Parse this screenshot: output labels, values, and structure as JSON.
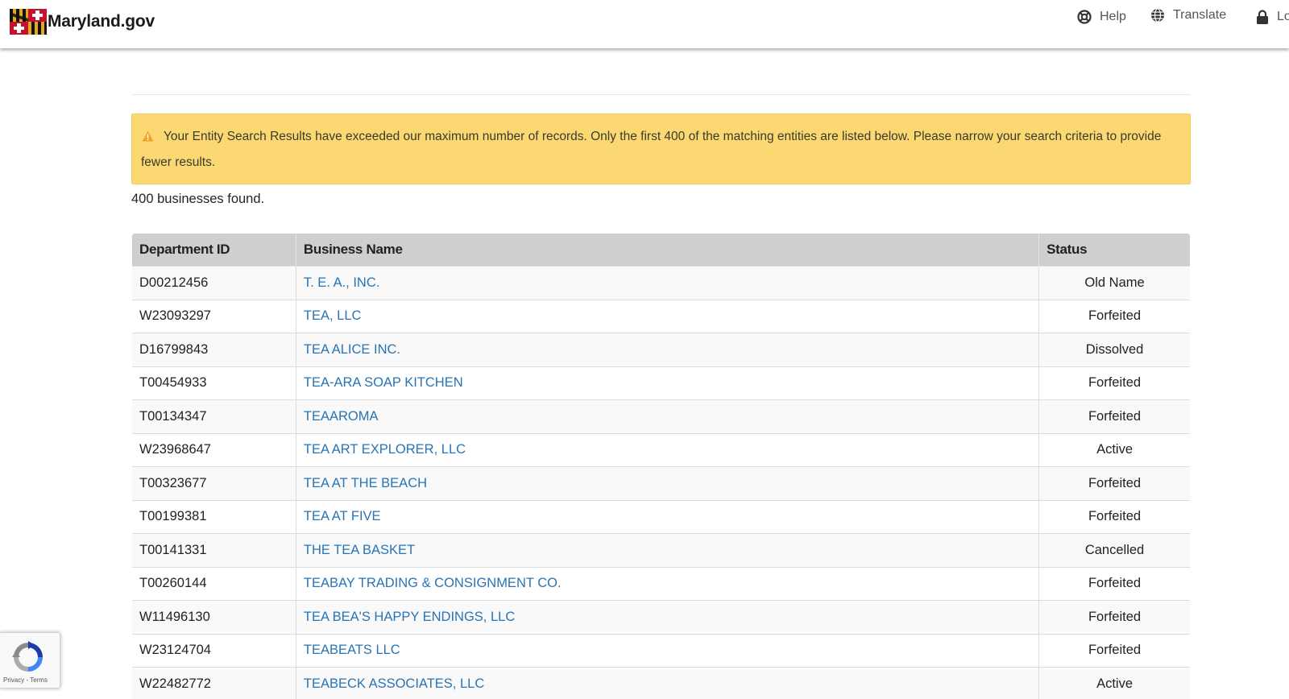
{
  "header": {
    "site_name": "Maryland.gov",
    "nav": {
      "help": "Help",
      "translate": "Translate",
      "login": "Lo"
    }
  },
  "alert": {
    "message": "Your Entity Search Results have exceeded our maximum number of records. Only the first 400 of the matching entities are listed below. Please narrow your search criteria to provide fewer results."
  },
  "results_count": "400 businesses found.",
  "table": {
    "headers": {
      "id": "Department ID",
      "name": "Business Name",
      "status": "Status"
    },
    "rows": [
      {
        "id": "D00212456",
        "name": "T. E. A., INC.",
        "status": "Old Name"
      },
      {
        "id": "W23093297",
        "name": "TEA, LLC",
        "status": "Forfeited"
      },
      {
        "id": "D16799843",
        "name": "TEA ALICE INC.",
        "status": "Dissolved"
      },
      {
        "id": "T00454933",
        "name": "TEA-ARA SOAP KITCHEN",
        "status": "Forfeited"
      },
      {
        "id": "T00134347",
        "name": "TEAAROMA",
        "status": "Forfeited"
      },
      {
        "id": "W23968647",
        "name": "TEA ART EXPLORER, LLC",
        "status": "Active"
      },
      {
        "id": "T00323677",
        "name": "TEA AT THE BEACH",
        "status": "Forfeited"
      },
      {
        "id": "T00199381",
        "name": "TEA AT FIVE",
        "status": "Forfeited"
      },
      {
        "id": "T00141331",
        "name": "THE TEA BASKET",
        "status": "Cancelled"
      },
      {
        "id": "T00260144",
        "name": "TEABAY TRADING & CONSIGNMENT CO.",
        "status": "Forfeited"
      },
      {
        "id": "W11496130",
        "name": "TEA BEA'S HAPPY ENDINGS, LLC",
        "status": "Forfeited"
      },
      {
        "id": "W23124704",
        "name": "TEABEATS LLC",
        "status": "Forfeited"
      },
      {
        "id": "W22482772",
        "name": "TEABECK ASSOCIATES, LLC",
        "status": "Active"
      }
    ]
  },
  "recaptcha": {
    "terms": "Privacy - Terms"
  },
  "colors": {
    "link": "#2874b5",
    "alert_bg": "#fbd872",
    "header_bg": "#cfcfcf"
  }
}
